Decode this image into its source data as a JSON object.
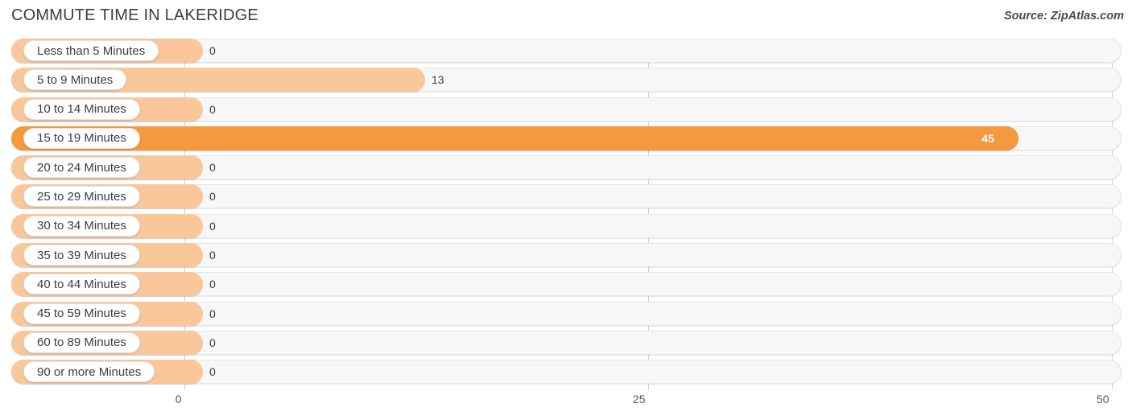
{
  "header": {
    "title": "COMMUTE TIME IN LAKERIDGE",
    "source": "Source: ZipAtlas.com"
  },
  "colors": {
    "bar_light": "#f9c79a",
    "bar_strong": "#f5993f",
    "track": "#f7f7f7",
    "gridline": "#d2d2d4",
    "text": "#3c3c46"
  },
  "chart_data": {
    "type": "bar",
    "orientation": "horizontal",
    "title": "COMMUTE TIME IN LAKERIDGE",
    "xlabel": "",
    "ylabel": "",
    "xlim": [
      0,
      50
    ],
    "xticks": [
      0,
      25,
      50
    ],
    "xtick_labels": [
      "0",
      "25",
      "50"
    ],
    "grid": true,
    "legend": false,
    "categories": [
      "Less than 5 Minutes",
      "5 to 9 Minutes",
      "10 to 14 Minutes",
      "15 to 19 Minutes",
      "20 to 24 Minutes",
      "25 to 29 Minutes",
      "30 to 34 Minutes",
      "35 to 39 Minutes",
      "40 to 44 Minutes",
      "45 to 59 Minutes",
      "60 to 89 Minutes",
      "90 or more Minutes"
    ],
    "values": [
      0,
      13,
      0,
      45,
      0,
      0,
      0,
      0,
      0,
      0,
      0,
      0
    ],
    "value_labels": [
      "0",
      "13",
      "0",
      "45",
      "0",
      "0",
      "0",
      "0",
      "0",
      "0",
      "0",
      "0"
    ]
  },
  "rows": [
    {
      "label": "Less than 5 Minutes",
      "value": 0,
      "value_label": "0",
      "inside": false
    },
    {
      "label": "5 to 9 Minutes",
      "value": 13,
      "value_label": "13",
      "inside": false
    },
    {
      "label": "10 to 14 Minutes",
      "value": 0,
      "value_label": "0",
      "inside": false
    },
    {
      "label": "15 to 19 Minutes",
      "value": 45,
      "value_label": "45",
      "inside": true
    },
    {
      "label": "20 to 24 Minutes",
      "value": 0,
      "value_label": "0",
      "inside": false
    },
    {
      "label": "25 to 29 Minutes",
      "value": 0,
      "value_label": "0",
      "inside": false
    },
    {
      "label": "30 to 34 Minutes",
      "value": 0,
      "value_label": "0",
      "inside": false
    },
    {
      "label": "35 to 39 Minutes",
      "value": 0,
      "value_label": "0",
      "inside": false
    },
    {
      "label": "40 to 44 Minutes",
      "value": 0,
      "value_label": "0",
      "inside": false
    },
    {
      "label": "45 to 59 Minutes",
      "value": 0,
      "value_label": "0",
      "inside": false
    },
    {
      "label": "60 to 89 Minutes",
      "value": 0,
      "value_label": "0",
      "inside": false
    },
    {
      "label": "90 or more Minutes",
      "value": 0,
      "value_label": "0",
      "inside": false
    }
  ]
}
